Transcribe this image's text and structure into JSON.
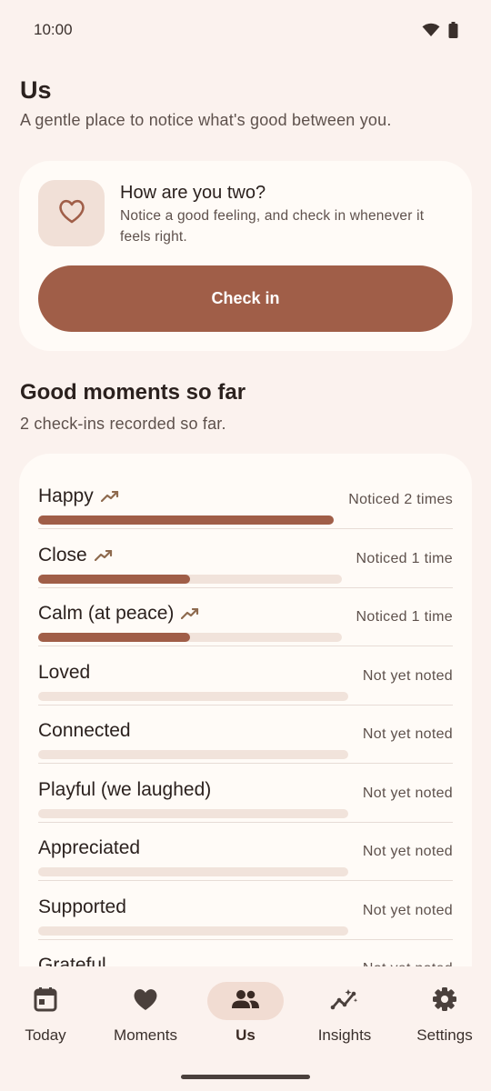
{
  "status_bar": {
    "time": "10:00"
  },
  "header": {
    "title": "Us",
    "subtitle": "A gentle place to notice what's good between you."
  },
  "checkin_card": {
    "title": "How are you two?",
    "description": "Notice a good feeling, and check in whenever it feels right.",
    "button_label": "Check in",
    "icon": "heart-outline-icon"
  },
  "moments": {
    "title": "Good moments so far",
    "subtitle": "2 check-ins recorded so far.",
    "items": [
      {
        "label": "Happy",
        "count_text": "Noticed 2 times",
        "fill": 1.0,
        "trending": true
      },
      {
        "label": "Close",
        "count_text": "Noticed 1 time",
        "fill": 0.5,
        "trending": true
      },
      {
        "label": "Calm (at peace)",
        "count_text": "Noticed 1 time",
        "fill": 0.5,
        "trending": true
      },
      {
        "label": "Loved",
        "count_text": "Not yet noted",
        "fill": 0,
        "trending": false
      },
      {
        "label": "Connected",
        "count_text": "Not yet noted",
        "fill": 0,
        "trending": false
      },
      {
        "label": "Playful (we laughed)",
        "count_text": "Not yet noted",
        "fill": 0,
        "trending": false
      },
      {
        "label": "Appreciated",
        "count_text": "Not yet noted",
        "fill": 0,
        "trending": false
      },
      {
        "label": "Supported",
        "count_text": "Not yet noted",
        "fill": 0,
        "trending": false
      },
      {
        "label": "Grateful",
        "count_text": "Not yet noted",
        "fill": 0,
        "trending": false
      }
    ]
  },
  "bottom_nav": {
    "items": [
      {
        "label": "Today",
        "icon": "calendar-icon",
        "active": false
      },
      {
        "label": "Moments",
        "icon": "heart-icon",
        "active": false
      },
      {
        "label": "Us",
        "icon": "people-icon",
        "active": true
      },
      {
        "label": "Insights",
        "icon": "insights-icon",
        "active": false
      },
      {
        "label": "Settings",
        "icon": "gear-icon",
        "active": false
      }
    ]
  },
  "colors": {
    "background": "#FBF2EE",
    "surface": "#FFFBF7",
    "accent": "#A05E48",
    "track": "#F1E3DB",
    "active_indicator": "#F1DCD2"
  }
}
